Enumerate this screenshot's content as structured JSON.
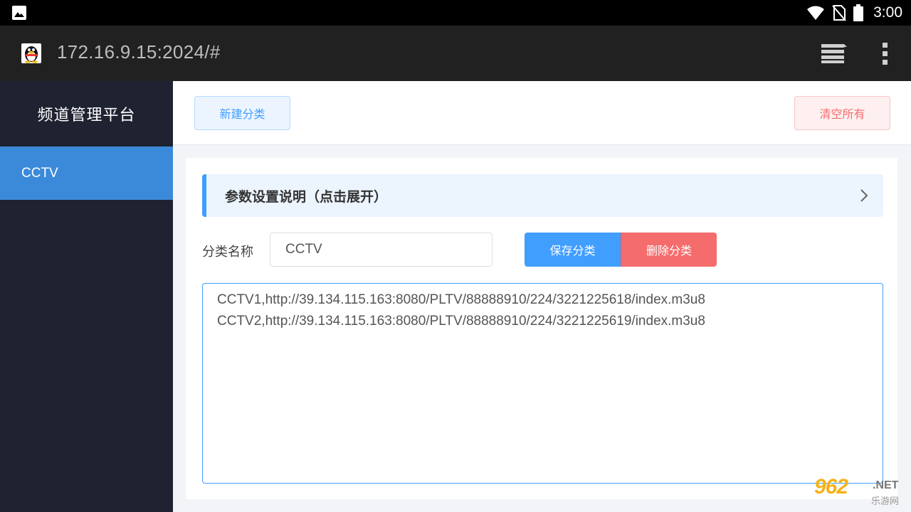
{
  "status_bar": {
    "time": "3:00",
    "icons": [
      "gallery-icon",
      "wifi-icon",
      "no-sim-icon",
      "battery-icon"
    ]
  },
  "browser": {
    "url": "172.16.9.15:2024/#",
    "icons": [
      "favicon-penguin-icon",
      "tabs-icon",
      "overflow-menu-icon"
    ]
  },
  "sidebar": {
    "title": "频道管理平台",
    "items": [
      {
        "label": "CCTV",
        "active": true
      }
    ]
  },
  "header": {
    "new_category_label": "新建分类",
    "clear_all_label": "清空所有"
  },
  "panel": {
    "collapse_title": "参数设置说明（点击展开）",
    "name_label": "分类名称",
    "name_value": "CCTV",
    "save_label": "保存分类",
    "delete_label": "删除分类",
    "content_lines": [
      "CCTV1,http://39.134.115.163:8080/PLTV/88888910/224/3221225618/index.m3u8",
      "CCTV2,http://39.134.115.163:8080/PLTV/88888910/224/3221225619/index.m3u8"
    ]
  },
  "watermark": {
    "number": "962",
    "net": ".NET",
    "cn": "乐游网"
  },
  "colors": {
    "primary": "#409eff",
    "danger": "#f56c6c",
    "sidebar_bg": "#1f2230",
    "sidebar_active": "#3b8ad9",
    "toolbar_bg": "#212121"
  }
}
